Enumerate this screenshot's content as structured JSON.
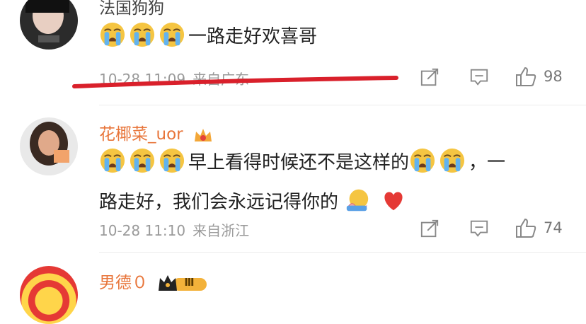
{
  "comments": [
    {
      "username": "法国狗狗",
      "text_after_emoji": "一路走好欢喜哥",
      "emoji_count": 3,
      "emoji_name": "crying-face",
      "date": "10-28 11:09",
      "location": "来自广东",
      "likes": "98",
      "username_color": "#444444"
    },
    {
      "username": "花椰菜_uor",
      "text_line1": "早上看得时候还不是这样的",
      "text_line1_tail": "，一",
      "text_line2": "路走好，我们会永远记得你的",
      "date": "10-28 11:10",
      "location": "来自浙江",
      "likes": "74",
      "username_color": "#e8753a"
    },
    {
      "username": "男德０",
      "badge_text": "Ⅲ",
      "username_color": "#e8753a"
    }
  ],
  "colors": {
    "annotation_line": "#d9202b",
    "meta_text": "#9a9a9a"
  }
}
